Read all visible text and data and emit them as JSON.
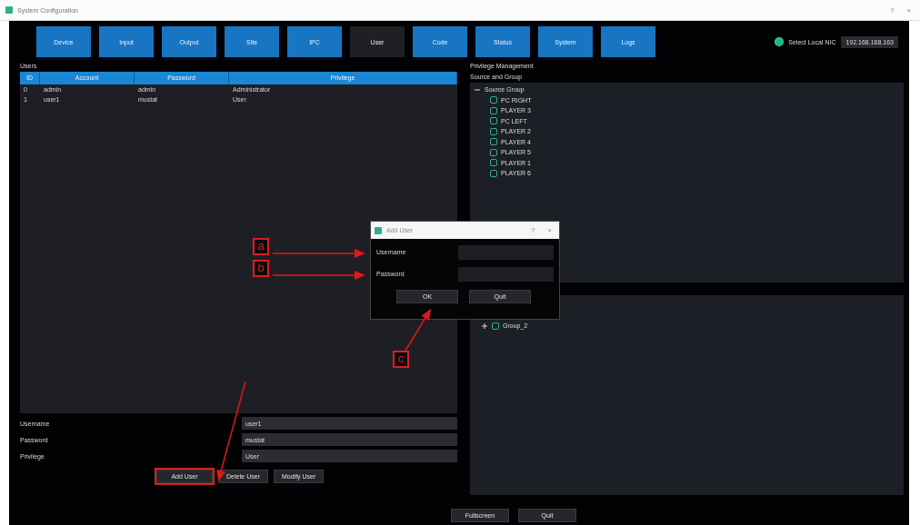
{
  "window": {
    "title": "System Configuration",
    "controls": [
      "?",
      "×"
    ]
  },
  "tabs": [
    {
      "label": "Device",
      "selected": false
    },
    {
      "label": "Input",
      "selected": false
    },
    {
      "label": "Output",
      "selected": false
    },
    {
      "label": "Site",
      "selected": false
    },
    {
      "label": "IPC",
      "selected": false
    },
    {
      "label": "User",
      "selected": true
    },
    {
      "label": "Code",
      "selected": false
    },
    {
      "label": "Status",
      "selected": false
    },
    {
      "label": "System",
      "selected": false
    },
    {
      "label": "Logs",
      "selected": false
    }
  ],
  "nic": {
    "label": "Select Local NIC",
    "value": "192.168.168.163"
  },
  "users": {
    "title": "Users",
    "columns": [
      "ID",
      "Account",
      "Password",
      "Privilege"
    ],
    "rows": [
      [
        "0",
        "admin",
        "admin",
        "Administrator"
      ],
      [
        "1",
        "user1",
        "mustat",
        "User"
      ]
    ]
  },
  "form": [
    {
      "label": "Username",
      "value": "user1"
    },
    {
      "label": "Password",
      "value": "mustat"
    },
    {
      "label": "Privilege",
      "value": "User"
    }
  ],
  "form_buttons": [
    {
      "label": "Add User",
      "highlighted": true
    },
    {
      "label": "Delete User",
      "highlighted": false
    },
    {
      "label": "Modify User",
      "highlighted": false
    }
  ],
  "privilege": {
    "title": "Privilege Management",
    "subtitle": "Source and Group",
    "source_tree": [
      {
        "label": "Source Group",
        "expanded": true,
        "children": [
          {
            "label": "PC RIGHT"
          },
          {
            "label": "PLAYER 3"
          },
          {
            "label": "PC LEFT"
          },
          {
            "label": "PLAYER 2"
          },
          {
            "label": "PLAYER 4"
          },
          {
            "label": "PLAYER 5"
          },
          {
            "label": "PLAYER 1"
          },
          {
            "label": "PLAYER 6"
          }
        ]
      }
    ],
    "group_tree": [
      {
        "label": "Group_2",
        "expanded": false
      }
    ]
  },
  "bottom_buttons": [
    "Fullscreen",
    "Quit"
  ],
  "dialog": {
    "title": "Add User",
    "controls": [
      "?",
      "×"
    ],
    "fields": [
      {
        "label": "Username"
      },
      {
        "label": "Password"
      }
    ],
    "buttons": [
      "OK",
      "Quit"
    ]
  },
  "annotations": [
    {
      "label": "a"
    },
    {
      "label": "b"
    },
    {
      "label": "c"
    }
  ]
}
